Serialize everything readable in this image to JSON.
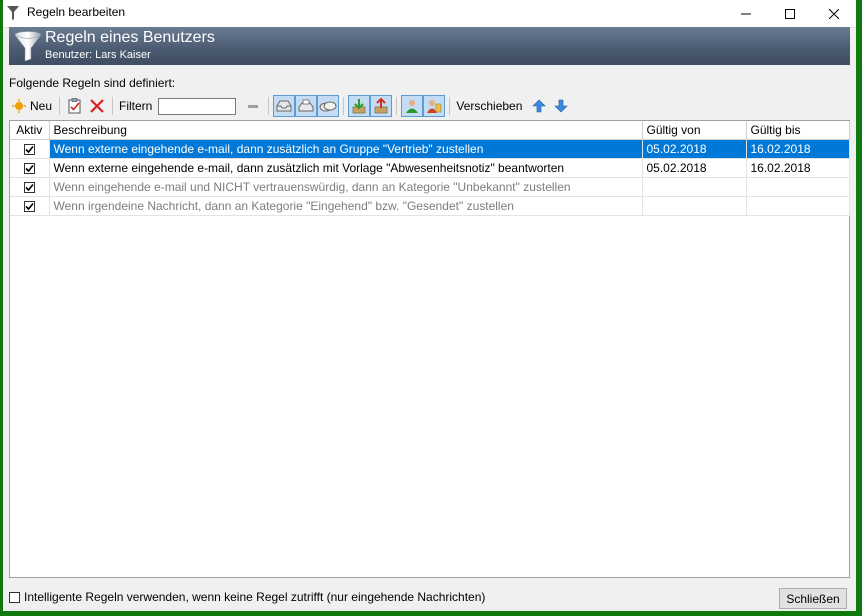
{
  "window": {
    "title": "Regeln bearbeiten"
  },
  "banner": {
    "title": "Regeln eines Benutzers",
    "subtitle": "Benutzer: Lars Kaiser"
  },
  "defined_label": "Folgende Regeln sind definiert:",
  "toolbar": {
    "new_label": "Neu",
    "filter_label": "Filtern",
    "filter_value": "",
    "move_label": "Verschieben"
  },
  "grid": {
    "columns": [
      "Aktiv",
      "Beschreibung",
      "Gültig von",
      "Gültig bis"
    ],
    "rows": [
      {
        "active": true,
        "description": "Wenn externe eingehende e-mail, dann zusätzlich an Gruppe \"Vertrieb\" zustellen",
        "from": "05.02.2018",
        "to": "16.02.2018"
      },
      {
        "active": true,
        "description": "Wenn externe eingehende e-mail, dann zusätzlich mit Vorlage \"Abwesenheitsnotiz\" beantworten",
        "from": "05.02.2018",
        "to": "16.02.2018"
      },
      {
        "active": true,
        "description": "Wenn eingehende e-mail und NICHT vertrauenswürdig, dann an Kategorie \"Unbekannt\" zustellen",
        "from": "",
        "to": ""
      },
      {
        "active": true,
        "description": "Wenn irgendeine Nachricht, dann an Kategorie \"Eingehend\" bzw. \"Gesendet\" zustellen",
        "from": "",
        "to": ""
      }
    ]
  },
  "footer": {
    "smart_rules_label": "Intelligente Regeln verwenden, wenn keine Regel zutrifft (nur eingehende Nachrichten)",
    "close_label": "Schließen"
  },
  "colors": {
    "selection": "#0078d7",
    "banner": "#4a5a70",
    "frame": "#0e7a0e"
  }
}
